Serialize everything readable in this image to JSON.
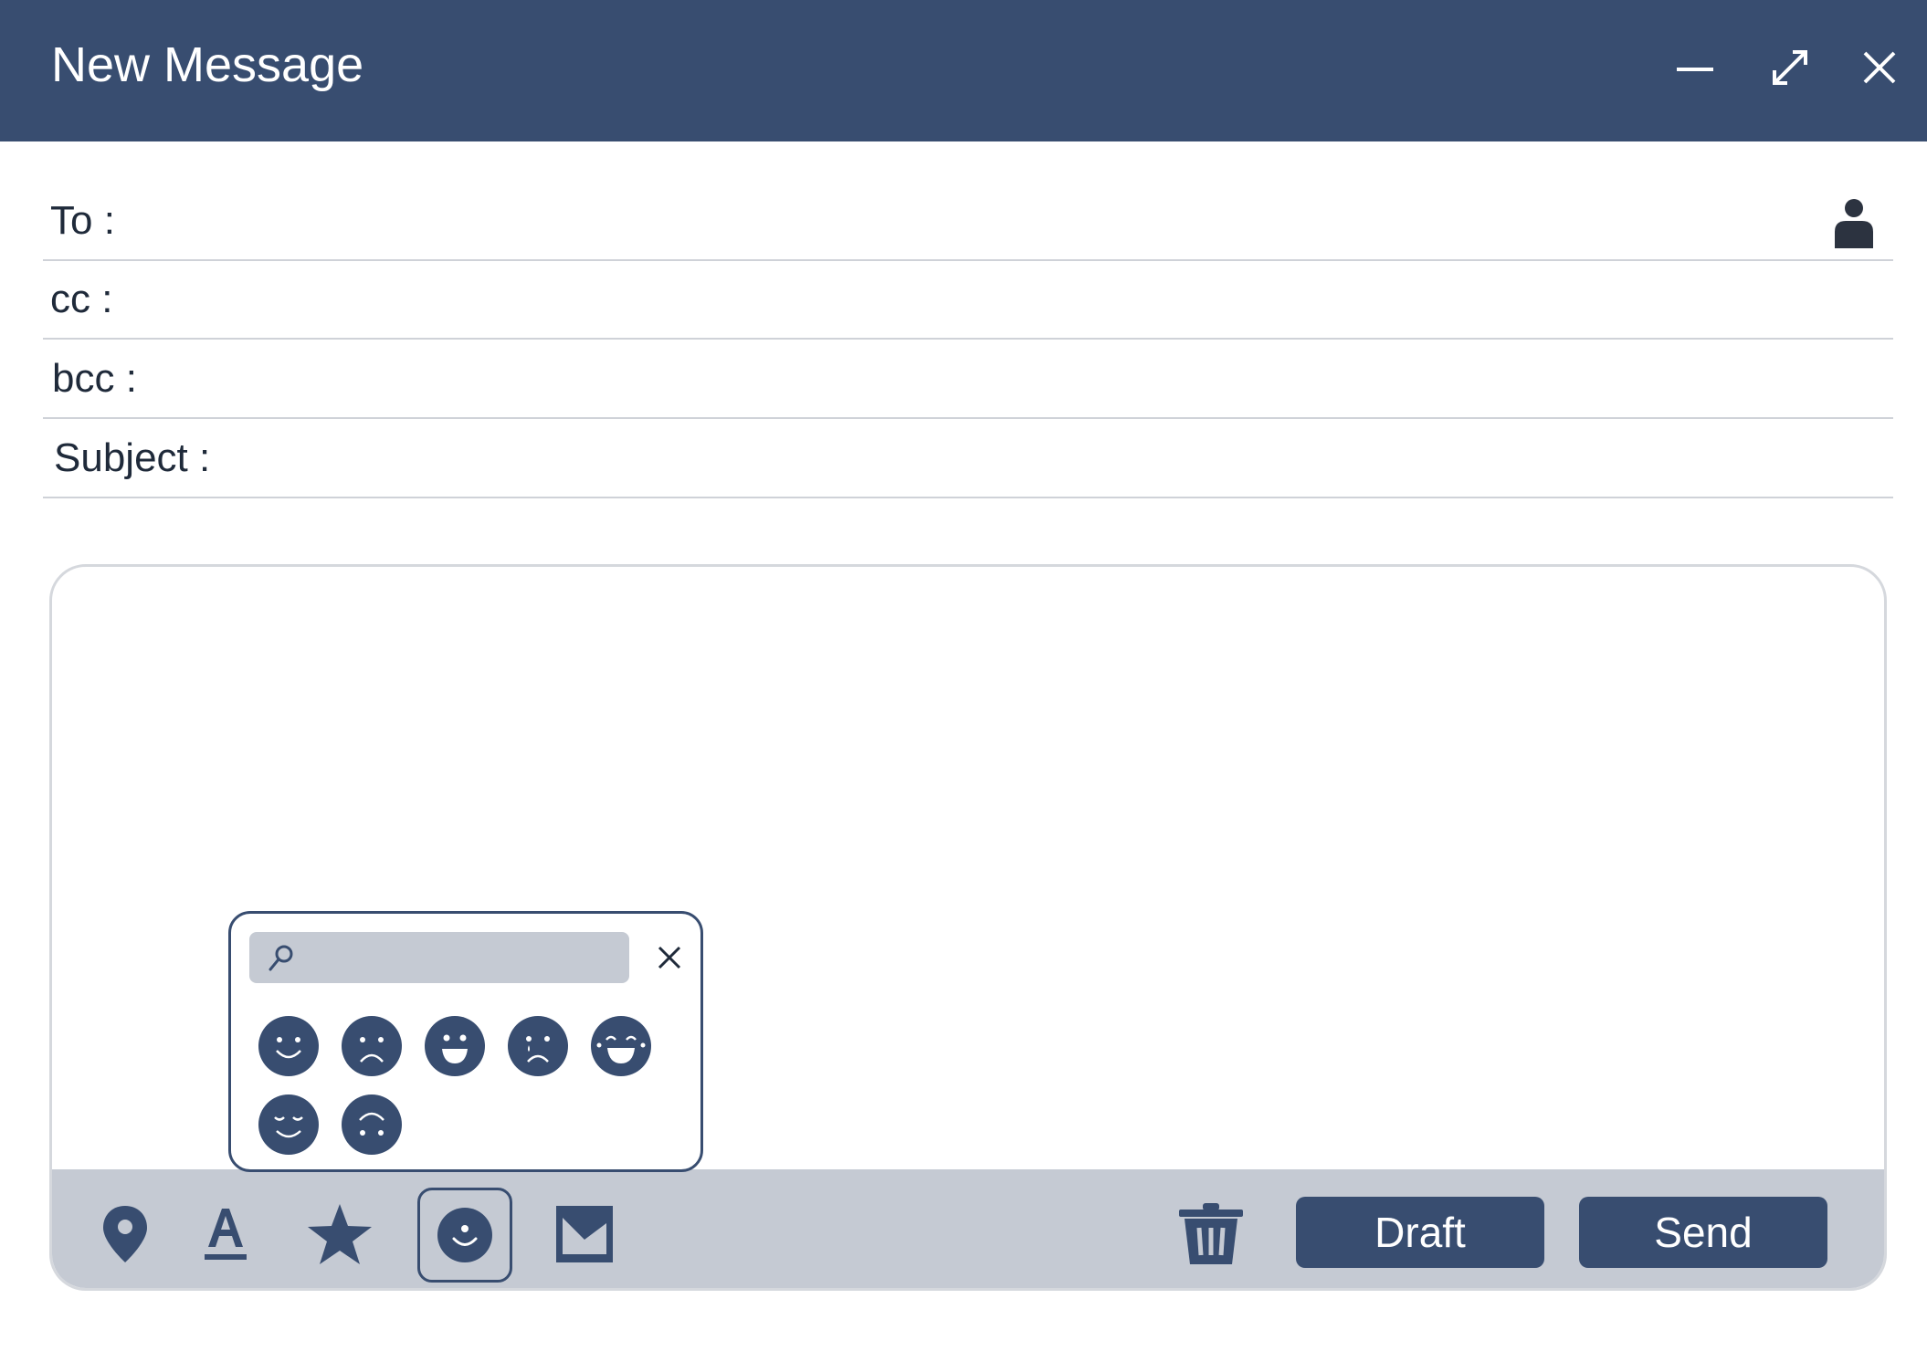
{
  "window": {
    "title": "New Message",
    "accent_color": "#384d70",
    "controls": [
      "minimize-icon",
      "expand-icon",
      "close-icon"
    ]
  },
  "fields": {
    "to": {
      "label": "To :",
      "value": ""
    },
    "cc": {
      "label": "cc :",
      "value": ""
    },
    "bcc": {
      "label": "bcc :",
      "value": ""
    },
    "subject": {
      "label": "Subject :",
      "value": ""
    }
  },
  "message_body": {
    "value": ""
  },
  "toolbar": {
    "tools": [
      "location-pin-icon",
      "text-format-icon",
      "star-icon",
      "emoji-icon",
      "image-icon"
    ],
    "active_tool": "emoji-icon",
    "delete_icon": "trash-icon",
    "draft_label": "Draft",
    "send_label": "Send"
  },
  "emoji_picker": {
    "search_value": "",
    "emojis": [
      "smile",
      "frown",
      "grin",
      "tearful",
      "laughing",
      "content",
      "upside-down"
    ]
  }
}
